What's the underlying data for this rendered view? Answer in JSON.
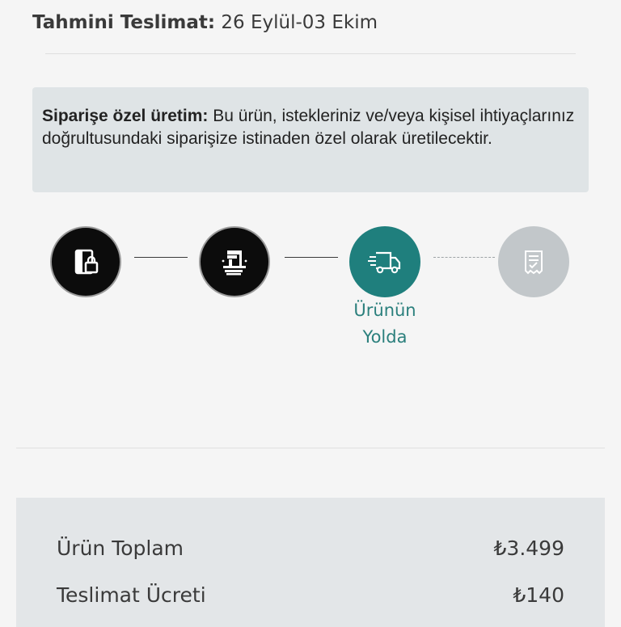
{
  "delivery": {
    "label": "Tahmini Teslimat:",
    "value": "26 Eylül-03 Ekim"
  },
  "notice": {
    "bold": "Siparişe özel üretim:",
    "text": "Bu ürün, istekleriniz ve/veya kişisel ihtiyaçlarınız doğrultusundaki siparişize istinaden özel olarak üretilecektir."
  },
  "tracker": {
    "steps": [
      {
        "icon": "order-lock-icon",
        "state": "done"
      },
      {
        "icon": "production-machine-icon",
        "state": "done"
      },
      {
        "icon": "delivery-truck-icon",
        "state": "active"
      },
      {
        "icon": "delivered-checklist-icon",
        "state": "pending"
      }
    ],
    "active_label_line1": "Ürünün",
    "active_label_line2": "Yolda",
    "colors": {
      "done": "#0c0c0c",
      "active": "#1f7f7d",
      "pending": "#c2c7ca"
    }
  },
  "summary": {
    "rows": [
      {
        "label": "Ürün Toplam",
        "value": "₺3.499"
      },
      {
        "label": "Teslimat Ücreti",
        "value": "₺140"
      }
    ]
  }
}
